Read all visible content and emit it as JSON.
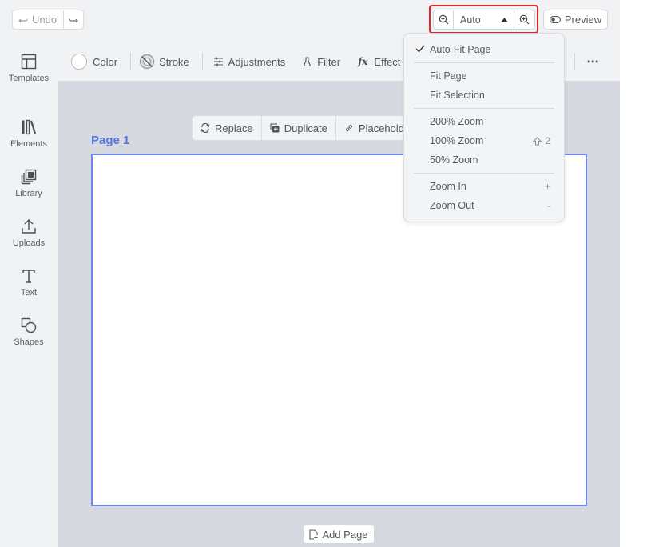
{
  "topbar": {
    "undo_label": "Undo",
    "zoom_value": "Auto",
    "preview_label": "Preview"
  },
  "sidebar": {
    "items": [
      {
        "label": "Templates",
        "icon": "templates-icon"
      },
      {
        "label": "Elements",
        "icon": "elements-icon"
      },
      {
        "label": "Library",
        "icon": "library-icon"
      },
      {
        "label": "Uploads",
        "icon": "upload-icon"
      },
      {
        "label": "Text",
        "icon": "text-icon"
      },
      {
        "label": "Shapes",
        "icon": "shapes-icon"
      }
    ]
  },
  "toolbar": {
    "color_label": "Color",
    "stroke_label": "Stroke",
    "adjustments_label": "Adjustments",
    "filter_label": "Filter",
    "effect_label": "Effect",
    "effect_prefix": "fx",
    "more_label": "⋯"
  },
  "context_bar": {
    "replace_label": "Replace",
    "duplicate_label": "Duplicate",
    "placeholder_label": "Placehold"
  },
  "page": {
    "title": "Page 1",
    "add_page_label": "Add Page"
  },
  "zoom_menu": {
    "auto_fit": "Auto-Fit Page",
    "fit_page": "Fit Page",
    "fit_selection": "Fit Selection",
    "zoom_200": "200% Zoom",
    "zoom_100": "100% Zoom",
    "zoom_100_shortcut": "2",
    "zoom_50": "50% Zoom",
    "zoom_in": "Zoom In",
    "zoom_in_shortcut": "+",
    "zoom_out": "Zoom Out",
    "zoom_out_shortcut": "-"
  },
  "colors": {
    "accent": "#6f86ee",
    "highlight": "#e0242b",
    "page_label": "#5a73e0"
  }
}
